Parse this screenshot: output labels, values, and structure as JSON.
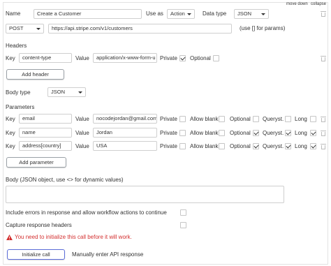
{
  "header": {
    "move_down": "move down",
    "collapse": "collapse"
  },
  "call": {
    "name_label": "Name",
    "name_value": "Create a Customer",
    "use_as_label": "Use as",
    "use_as_value": "Action",
    "data_type_label": "Data type",
    "data_type_value": "JSON",
    "method_value": "POST",
    "url_value": "https://api.stripe.com/v1/customers",
    "params_hint": "(use [] for params)"
  },
  "headers": {
    "title": "Headers",
    "key_label": "Key",
    "key_value": "content-type",
    "value_label": "Value",
    "value_value": "application/x-www-form-u",
    "private_label": "Private",
    "private_checked": true,
    "optional_label": "Optional",
    "optional_checked": false,
    "add_button": "Add header"
  },
  "body_type": {
    "label": "Body type",
    "value": "JSON"
  },
  "parameters": {
    "title": "Parameters",
    "key_label": "Key",
    "value_label": "Value",
    "private_label": "Private",
    "allow_blank_label": "Allow blank",
    "optional_label": "Optional",
    "queryst_label": "Queryst.",
    "long_label": "Long",
    "rows": [
      {
        "key": "email",
        "value": "nocodejordan@gmail.com",
        "private": false,
        "allow_blank": false,
        "optional": false,
        "queryst": false,
        "long": false
      },
      {
        "key": "name",
        "value": "Jordan",
        "private": false,
        "allow_blank": false,
        "optional": true,
        "queryst": true,
        "long": true
      },
      {
        "key": "address[country]",
        "value": "USA",
        "private": false,
        "allow_blank": false,
        "optional": true,
        "queryst": true,
        "long": true
      }
    ],
    "add_button": "Add parameter"
  },
  "body": {
    "label": "Body (JSON object, use <> for dynamic values)"
  },
  "options": {
    "include_errors_label": "Include errors in response and allow workflow actions to continue",
    "include_errors_checked": false,
    "capture_headers_label": "Capture response headers",
    "capture_headers_checked": false
  },
  "warning": {
    "text": "You need to initialize this call before it will work."
  },
  "footer": {
    "initialize_button": "Initialize call",
    "manual_link": "Manually enter API response"
  },
  "colors": {
    "warning": "#d32f2f",
    "primary_border": "#5b6cd8"
  }
}
